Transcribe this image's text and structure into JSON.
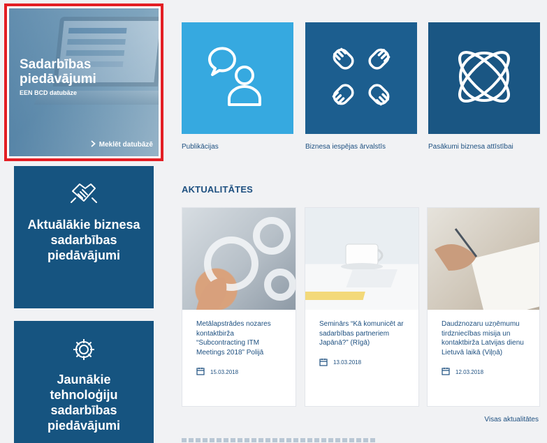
{
  "promo": {
    "title": "Sadarbības piedāvājumi",
    "subtitle": "EEN BCD datubāze",
    "link": "Meklēt datubāzē"
  },
  "side_tiles": [
    {
      "label": "Aktuālākie biznesa sadarbības piedāvājumi",
      "icon": "handshake-icon"
    },
    {
      "label": "Jaunākie tehnoloģiju sadarbības piedāvājumi",
      "icon": "gear-icon"
    }
  ],
  "quick_links": [
    {
      "label": "Publikācijas",
      "icon": "people-chat-icon"
    },
    {
      "label": "Biznesa iespējas ārvalstīs",
      "icon": "four-hands-icon"
    },
    {
      "label": "Pasākumi biznesa attīstībai",
      "icon": "orbit-icon"
    }
  ],
  "news": {
    "title": "AKTUALITĀTES",
    "items": [
      {
        "title": "Metālapstrādes nozares kontaktbirža “Subcontracting ITM Meetings 2018” Polijā",
        "date": "15.03.2018",
        "image": "gears-image"
      },
      {
        "title": "Seminārs “Kā komunicēt ar sadarbības partneriem Japānā?” (Rīgā)",
        "date": "13.03.2018",
        "image": "desk-image"
      },
      {
        "title": "Daudznozaru uzņēmumu tirdzniecības misija un kontaktbirža Latvijas dienu Lietuvā laikā (Viļņā)",
        "date": "12.03.2018",
        "image": "hand-writing-image"
      }
    ],
    "all_link": "Visas aktualitātes"
  },
  "colors": {
    "accent_light": "#36a9e0",
    "accent_dark": "#165480",
    "highlight_border": "#e31e24",
    "text": "#1e5080"
  }
}
